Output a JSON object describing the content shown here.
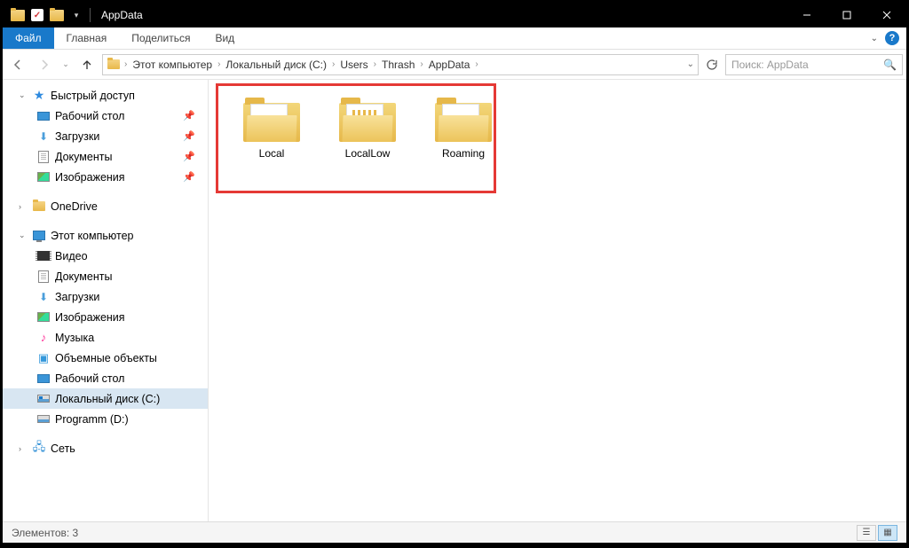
{
  "window": {
    "title": "AppData"
  },
  "ribbon": {
    "file": "Файл",
    "tabs": [
      "Главная",
      "Поделиться",
      "Вид"
    ]
  },
  "breadcrumb": {
    "items": [
      "Этот компьютер",
      "Локальный диск (C:)",
      "Users",
      "Thrash",
      "AppData"
    ]
  },
  "search": {
    "placeholder": "Поиск: AppData"
  },
  "navpane": {
    "quick_access": "Быстрый доступ",
    "quick_items": [
      {
        "label": "Рабочий стол",
        "pinned": true
      },
      {
        "label": "Загрузки",
        "pinned": true
      },
      {
        "label": "Документы",
        "pinned": true
      },
      {
        "label": "Изображения",
        "pinned": true
      }
    ],
    "onedrive": "OneDrive",
    "this_pc": "Этот компьютер",
    "pc_items": [
      "Видео",
      "Документы",
      "Загрузки",
      "Изображения",
      "Музыка",
      "Объемные объекты",
      "Рабочий стол",
      "Локальный диск (C:)",
      "Programm (D:)"
    ],
    "network": "Сеть"
  },
  "folders": [
    "Local",
    "LocalLow",
    "Roaming"
  ],
  "status": {
    "count_label": "Элементов: 3"
  }
}
